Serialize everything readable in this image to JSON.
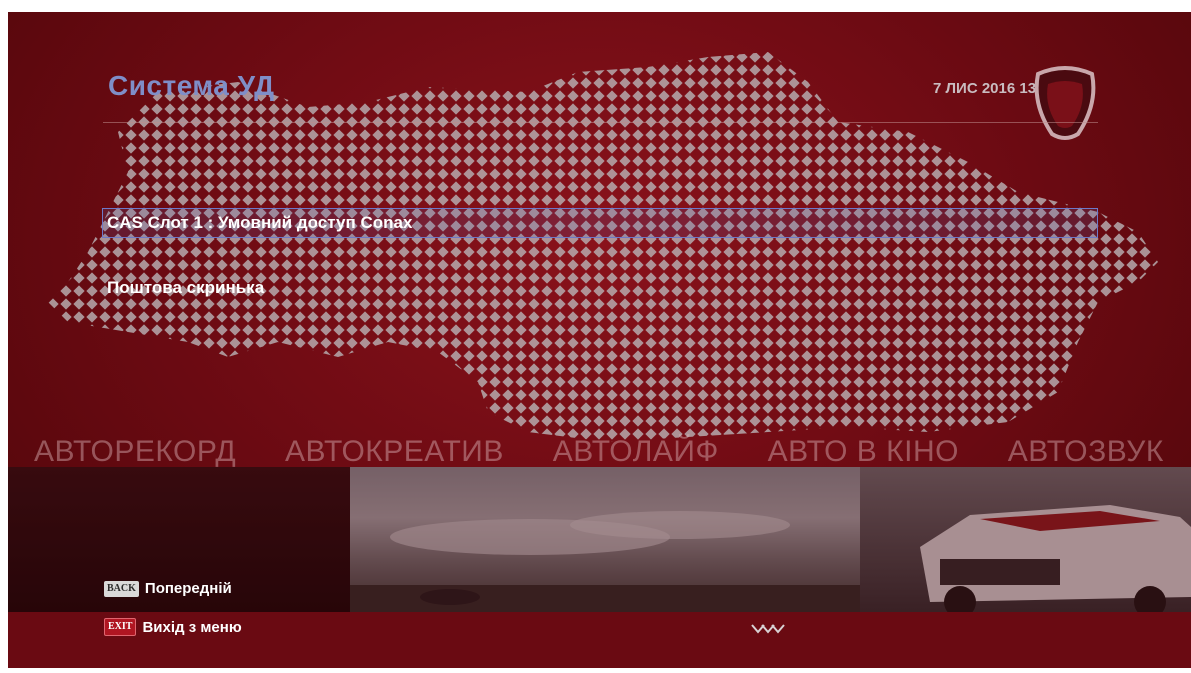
{
  "header": {
    "title": "Система УД",
    "datetime": "7 ЛИС 2016 13:55"
  },
  "menu": {
    "items": [
      {
        "label": "CAS Слот 1 : Умовний доступ Conax",
        "selected": true
      },
      {
        "label": "Поштова скринька",
        "selected": false
      }
    ]
  },
  "channels": [
    "АВТОРЕКОРД",
    "АВТОКРЕАТИВ",
    "АВТОЛАЙФ",
    "АВТО В КІНО",
    "АВТОЗВУК"
  ],
  "footer": {
    "back_key": "BACK",
    "back_label": "Попередній",
    "exit_key": "EXIT",
    "exit_label": "Вихід з меню"
  },
  "colors": {
    "background": "#6a0a12",
    "title": "#7f8ec8",
    "selection_border": "#6e79c8"
  },
  "icons": [
    "channel-logo-icon",
    "down-arrows-icon"
  ]
}
